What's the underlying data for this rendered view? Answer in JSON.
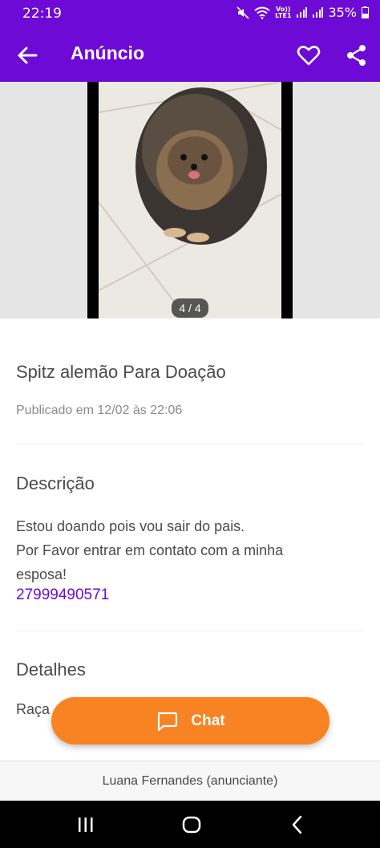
{
  "status_bar": {
    "time": "22:19",
    "network_top": "Vo))",
    "network_bottom": "LTE1",
    "battery": "35%"
  },
  "app_bar": {
    "title": "Anúncio",
    "icons": [
      "arrow-left-icon",
      "heart-outline-icon",
      "share-icon"
    ]
  },
  "gallery": {
    "counter": "4 / 4"
  },
  "ad": {
    "title": "Spitz alemão Para Doação",
    "published": "Publicado em 12/02 às 22:06"
  },
  "description": {
    "heading": "Descrição",
    "lines": [
      "Estou doando pois vou sair do pais.",
      "Por Favor entrar em contato com a minha",
      "esposa!"
    ],
    "phone": "27999490571"
  },
  "details": {
    "heading": "Detalhes",
    "first_label": "Raça"
  },
  "chat_button": {
    "label": "Chat"
  },
  "footer": {
    "advertiser": "Luana Fernandes (anunciante)"
  },
  "colors": {
    "brand_purple": "#6e0ad6",
    "chat_orange": "#f78323",
    "phone_link": "#6e0ad6"
  }
}
